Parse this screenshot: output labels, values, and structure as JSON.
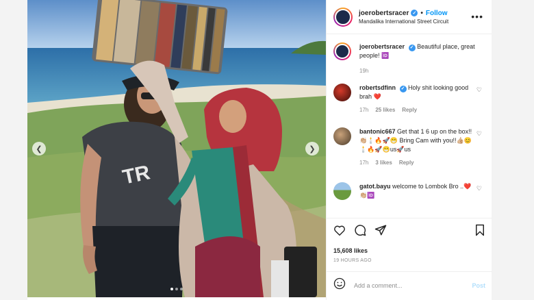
{
  "post": {
    "username": "joerobertsracer",
    "follow_label": "Follow",
    "location": "Mandalika International Street Circuit",
    "more_icon": "more-horizontal-icon"
  },
  "caption": {
    "username": "joerobertsracer",
    "text": "Beautiful place, great people! 🆔",
    "time": "19h"
  },
  "comments": [
    {
      "username": "robertsdfinn",
      "verified": true,
      "text": "Holy shit looking good brah ❤️",
      "time": "17h",
      "likes": "25 likes",
      "reply": "Reply"
    },
    {
      "username": "bantonic667",
      "verified": false,
      "text": "Get that 1 6 up on the box!!👏🏼🕯️🔥🚀😁 Bring Cam with you!!👍🏼😊🕯️🔥🚀😁us🚀us",
      "time": "17h",
      "likes": "3 likes",
      "reply": "Reply"
    },
    {
      "username": "gatot.bayu",
      "verified": false,
      "text": "welcome to Lombok Bro ..❤️👏🏼🆔",
      "time": "",
      "likes": "",
      "reply": ""
    }
  ],
  "stats": {
    "likes": "15,608 likes",
    "time": "19 HOURS AGO"
  },
  "add_comment": {
    "placeholder": "Add a comment...",
    "post_label": "Post"
  },
  "colors": {
    "accent": "#0095f6",
    "verified": "#3897f0",
    "heart": "#ed4956"
  }
}
